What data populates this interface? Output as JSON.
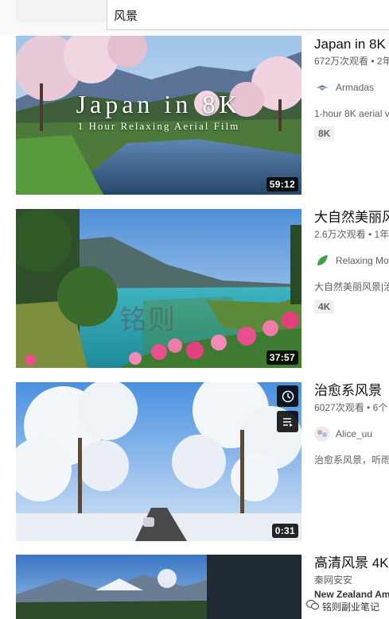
{
  "search": {
    "query": "风景"
  },
  "results": [
    {
      "title": "Japan in 8K",
      "views": "672万次观看 • 2年",
      "channel": "Armadas",
      "description": "1-hour 8K aerial v",
      "badge": "8K",
      "duration": "59:12",
      "thumb_title": "Japan in 8K",
      "thumb_subtitle": "1 Hour Relaxing Aerial Film"
    },
    {
      "title": "大自然美丽风",
      "views": "2.6万次观看 • 1年",
      "channel": "Relaxing Mo",
      "description": "大自然美丽风景|治",
      "badge": "4K",
      "duration": "37:57"
    },
    {
      "title": "治愈系风景",
      "views": "6027次观看 • 6个",
      "channel": "Alice_uu",
      "description": "治愈系风景，听雨",
      "duration": "0:31"
    },
    {
      "title": "高清风景 4K",
      "views": "秦网安安",
      "channel_line2": "New Zealand Am"
    }
  ],
  "watermark": {
    "middle": "铭则",
    "bottom": "铭则副业笔记"
  },
  "colors": {
    "duration_bg": "#000000",
    "meta_text": "#606060",
    "badge_bg": "#f0f0f0"
  },
  "icons": [
    "clock-icon",
    "queue-icon",
    "armadas-logo-icon",
    "leaf-logo-icon",
    "alice-avatar-icon",
    "wechat-icon"
  ]
}
